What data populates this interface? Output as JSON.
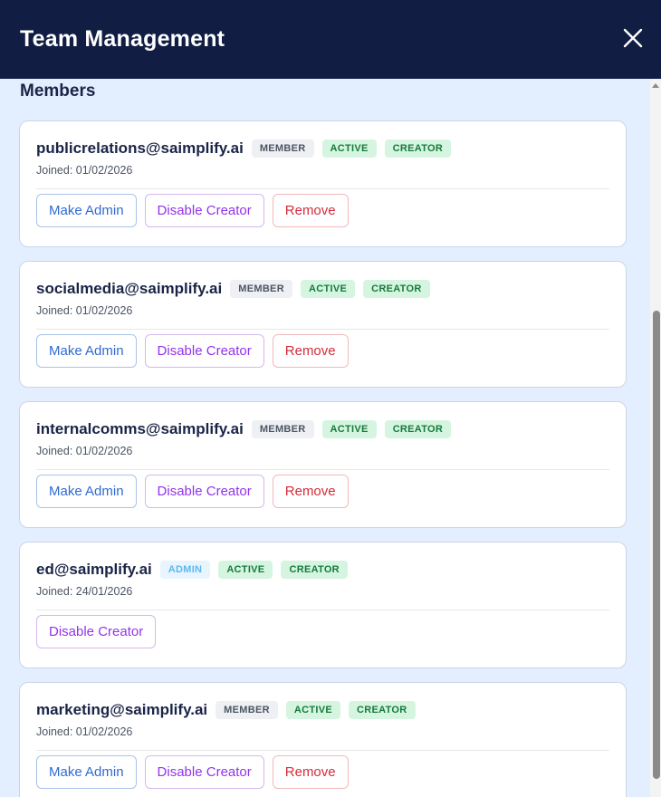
{
  "modal": {
    "title": "Team Management"
  },
  "section": {
    "title": "Members"
  },
  "members": [
    {
      "email": "publicrelations@saimplify.ai",
      "badges": [
        "MEMBER",
        "ACTIVE",
        "CREATOR"
      ],
      "joined": "Joined: 01/02/2026",
      "actions": [
        "Make Admin",
        "Disable Creator",
        "Remove"
      ]
    },
    {
      "email": "socialmedia@saimplify.ai",
      "badges": [
        "MEMBER",
        "ACTIVE",
        "CREATOR"
      ],
      "joined": "Joined: 01/02/2026",
      "actions": [
        "Make Admin",
        "Disable Creator",
        "Remove"
      ]
    },
    {
      "email": "internalcomms@saimplify.ai",
      "badges": [
        "MEMBER",
        "ACTIVE",
        "CREATOR"
      ],
      "joined": "Joined: 01/02/2026",
      "actions": [
        "Make Admin",
        "Disable Creator",
        "Remove"
      ]
    },
    {
      "email": "ed@saimplify.ai",
      "badges": [
        "ADMIN",
        "ACTIVE",
        "CREATOR"
      ],
      "joined": "Joined: 24/01/2026",
      "actions": [
        "Disable Creator"
      ]
    },
    {
      "email": "marketing@saimplify.ai",
      "badges": [
        "MEMBER",
        "ACTIVE",
        "CREATOR"
      ],
      "joined": "Joined: 01/02/2026",
      "actions": [
        "Make Admin",
        "Disable Creator",
        "Remove"
      ]
    }
  ],
  "colors": {
    "header_bg": "#111d42",
    "body_bg": "#e3eeff",
    "admin_action": "#2f6bd1",
    "creator_action": "#9333ea",
    "remove_action": "#d42c3b",
    "badge_green": "#157a3c"
  }
}
